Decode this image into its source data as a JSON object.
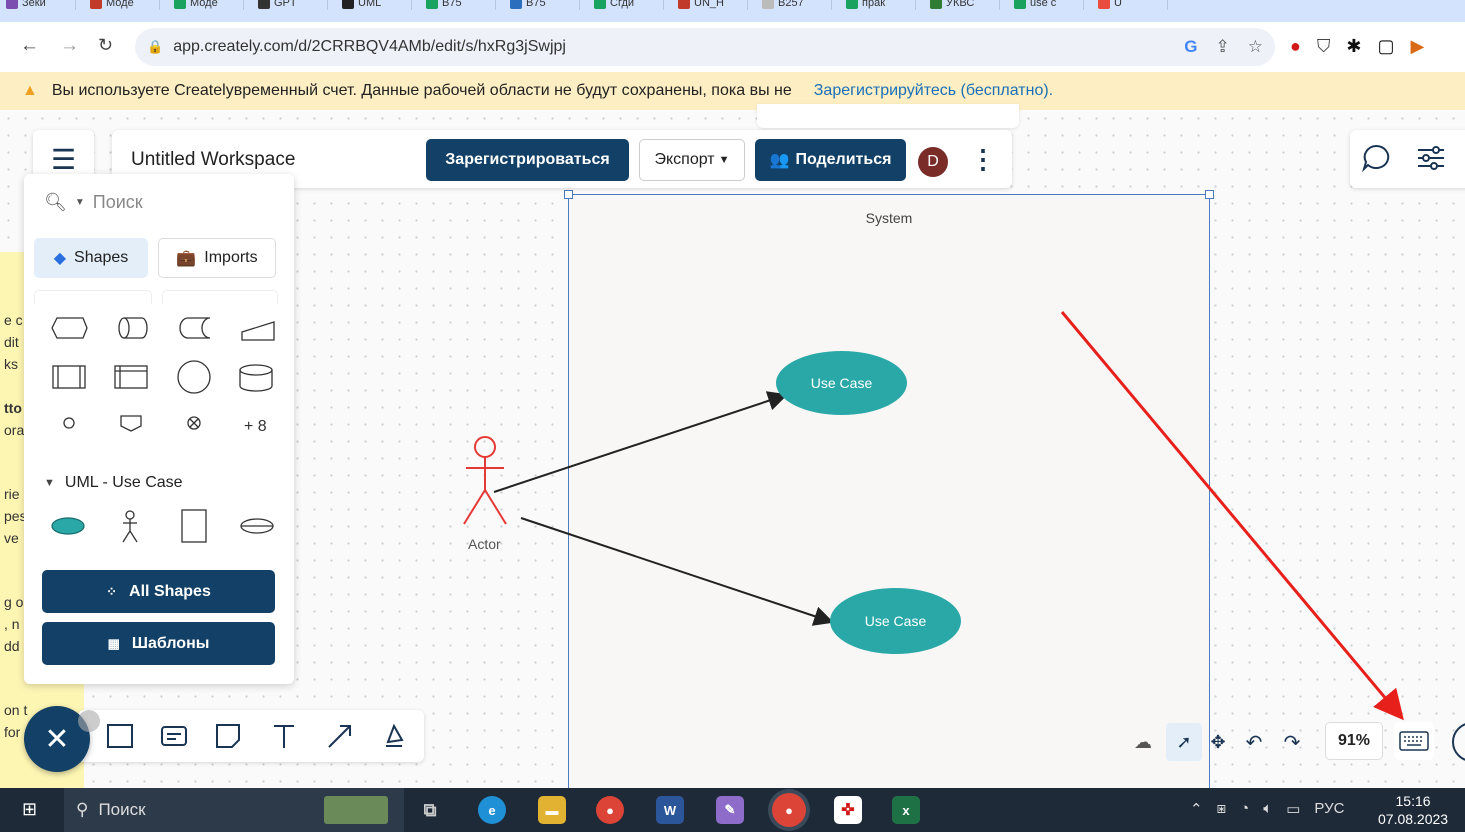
{
  "browser": {
    "url": "app.creately.com/d/2CRRBQV4AMb/edit/s/hxRg3jSwjpj",
    "tabs": [
      {
        "label": "Зеки",
        "color": "#7b4db0"
      },
      {
        "label": "Моде",
        "color": "#c0392b"
      },
      {
        "label": "Моде",
        "color": "#1aa260"
      },
      {
        "label": "GPT",
        "color": "#333333"
      },
      {
        "label": "UML",
        "color": "#222222"
      },
      {
        "label": "B75",
        "color": "#1aa260"
      },
      {
        "label": "B75",
        "color": "#2a6ebd"
      },
      {
        "label": "Сгди",
        "color": "#1aa260"
      },
      {
        "label": "UN_H",
        "color": "#c0392b"
      },
      {
        "label": "B257",
        "color": "#bbbbbb"
      },
      {
        "label": "прак",
        "color": "#1aa260"
      },
      {
        "label": "УКВС",
        "color": "#2e7d32"
      },
      {
        "label": "use c",
        "color": "#1aa260"
      },
      {
        "label": "U",
        "color": "#e74c3c"
      }
    ]
  },
  "banner": {
    "text": "Вы используете Createlyвременный счет. Данные рабочей области не будут сохранены, пока вы не",
    "link": "Зарегистрируйтесь (бесплатно)."
  },
  "toolbar": {
    "workspace_title": "Untitled Workspace",
    "register_label": "Зарегистрироваться",
    "export_label": "Экспорт",
    "share_label": "Поделиться",
    "avatar_initial": "D"
  },
  "shape_panel": {
    "search_placeholder": "Поиск",
    "tab_shapes": "Shapes",
    "tab_imports": "Imports",
    "more_count": "+ 8",
    "section_title": "UML - Use Case",
    "all_shapes_label": "All Shapes",
    "templates_label": "Шаблоны"
  },
  "diagram": {
    "system_label": "System",
    "actor_label": "Actor",
    "use_case_1": "Use Case",
    "use_case_2": "Use Case"
  },
  "left_panel_fragments": [
    "e c",
    "dit",
    "ks",
    "tto",
    "ora",
    "rie",
    "pes",
    "ve",
    "g o",
    ", n",
    "dd",
    "on t",
    "for"
  ],
  "zoom": "91%",
  "taskbar": {
    "search_label": "Поиск",
    "language": "РУС",
    "time": "15:16",
    "date": "07.08.2023"
  },
  "colors": {
    "accent_dark": "#124066",
    "use_case_fill": "#2aa8a8",
    "actor_stroke": "#e53935",
    "annotation_arrow": "#e8201c"
  }
}
